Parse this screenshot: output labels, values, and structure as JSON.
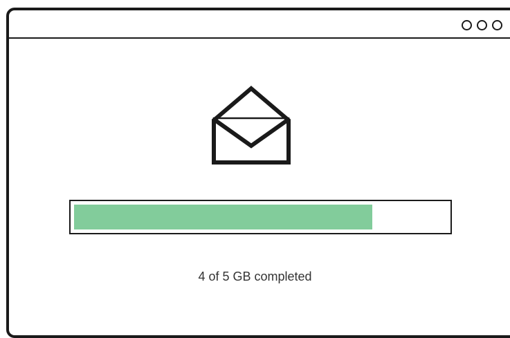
{
  "window": {
    "controls": [
      "window-control-dot",
      "window-control-dot",
      "window-control-dot"
    ]
  },
  "icon": {
    "name": "open-envelope-icon",
    "color": "#1a1a1a"
  },
  "progress": {
    "fraction": 0.8,
    "fill_color": "#82cc9b",
    "track_color": "#ffffff",
    "border_color": "#1a1a1a"
  },
  "status": {
    "text": "4 of 5 GB completed"
  }
}
